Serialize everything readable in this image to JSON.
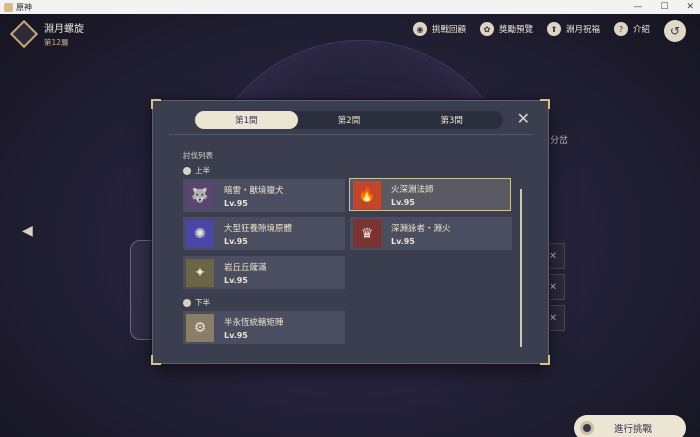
{
  "window": {
    "title": "原神",
    "controls": [
      "—",
      "☐",
      "✕"
    ]
  },
  "event": {
    "title": "淵月螺旋",
    "floor": "第12層"
  },
  "top_menu": [
    {
      "label": "挑戰回顧",
      "icon": "rewind-icon"
    },
    {
      "label": "獎勵預覽",
      "icon": "gift-icon"
    },
    {
      "label": "淵月祝福",
      "icon": "blessing-icon"
    },
    {
      "label": "介紹",
      "icon": "help-icon"
    }
  ],
  "background": {
    "score_text": "分岔"
  },
  "panel": {
    "tabs": [
      "第1間",
      "第2間",
      "第3間"
    ],
    "active_tab": 0,
    "list_title": "討伐列表",
    "first_half_label": "上半",
    "second_half_label": "下半",
    "first_half": [
      {
        "name": "暗雷・獸境獵犬",
        "level": "Lv.95",
        "glyph": "🐺",
        "color": "#5a4470"
      },
      {
        "name": "火深淵法師",
        "level": "Lv.95",
        "glyph": "🔥",
        "color": "#c2462a",
        "selected": true
      },
      {
        "name": "大型狂養隙境原體",
        "level": "Lv.95",
        "glyph": "✺",
        "color": "#4b47a8"
      },
      {
        "name": "深淵詠者・淵火",
        "level": "Lv.95",
        "glyph": "♛",
        "color": "#7a3330"
      },
      {
        "name": "岩丘丘薩滿",
        "level": "Lv.95",
        "glyph": "✦",
        "color": "#6b6545"
      }
    ],
    "second_half": [
      {
        "name": "半永恆統轄矩陣",
        "level": "Lv.95",
        "glyph": "⚙",
        "color": "#8a7f66"
      }
    ]
  },
  "start_button": {
    "label": "進行挑戰"
  }
}
